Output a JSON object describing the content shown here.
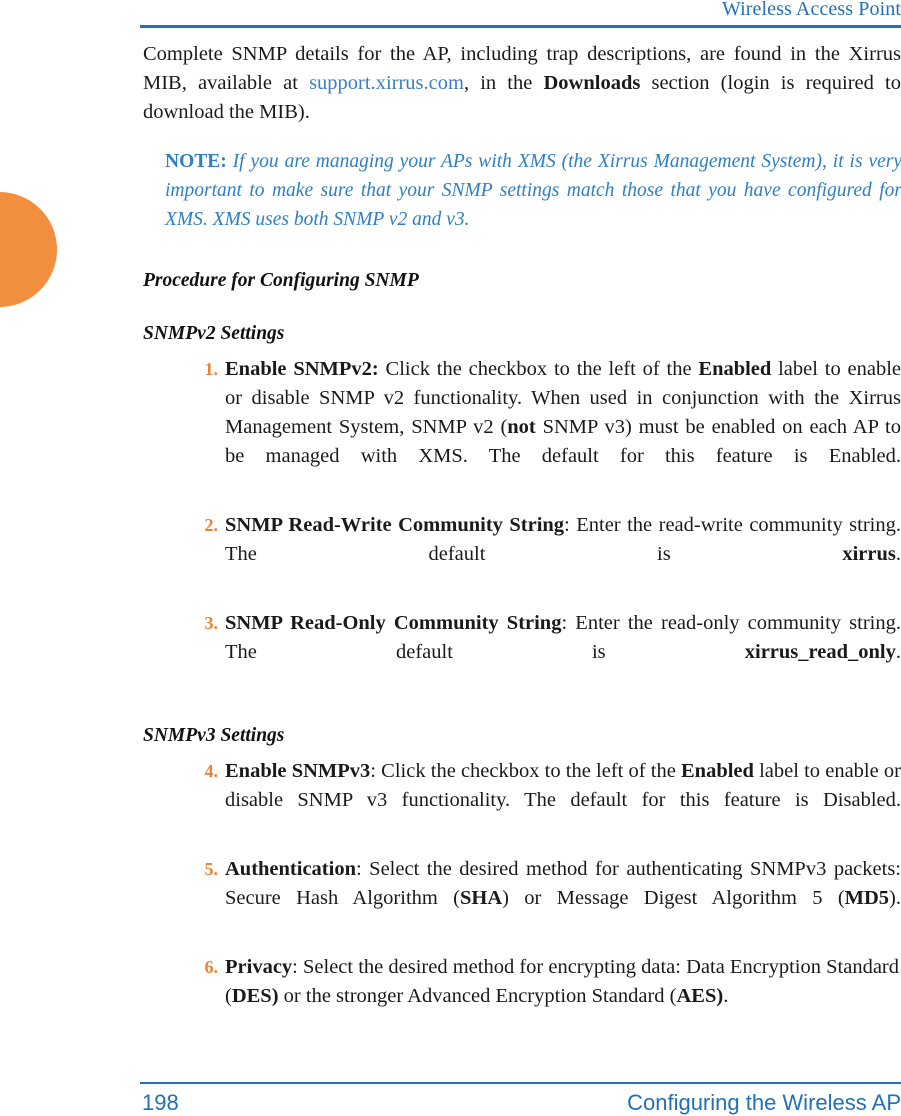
{
  "header": {
    "title": "Wireless Access Point"
  },
  "decor": {
    "thumb_tab_color": "#F28F3E",
    "rule_color": "#2170B8",
    "link_color": "#3D7EBE",
    "note_color": "#2E7FC4",
    "number_color": "#F08033"
  },
  "intro": {
    "segment_1": "Complete SNMP details for the AP, including trap descriptions, are found in the Xirrus MIB, available at ",
    "link_text": "support.xirrus.com",
    "segment_2": ", in the ",
    "bold_downloads": "Downloads",
    "segment_3": " section (login is required to download the MIB)."
  },
  "note": {
    "label": "NOTE:",
    "text": " If you are managing your APs with XMS (the Xirrus Management System), it is very important to make sure that your SNMP settings match those that you have configured for XMS. XMS uses both SNMP v2 and v3."
  },
  "procedure_heading": "Procedure for Configuring SNMP",
  "sections": [
    {
      "heading": "SNMPv2 Settings",
      "steps": [
        {
          "number": "1.",
          "bold_lead": "Enable SNMPv2:",
          "text_a": " Click the checkbox to the left of the ",
          "bold_mid": "Enabled",
          "text_b": " label to enable or disable SNMP v2 functionality. When used in conjunction with the Xirrus Management System, SNMP v2 (",
          "bold_mid_2": "not",
          "text_c": " SNMP v3) must be enabled on each AP to be managed with XMS. The default for this feature is Enabled."
        },
        {
          "number": "2.",
          "bold_lead": "SNMP Read-Write Community String",
          "text_a": ": Enter the read-write community string. The default is ",
          "bold_mid": "xirrus",
          "text_b": "."
        },
        {
          "number": "3.",
          "bold_lead": "SNMP Read-Only Community String",
          "text_a": ": Enter the read-only community string. The default is ",
          "bold_mid": "xirrus_read_only",
          "text_b": "."
        }
      ]
    },
    {
      "heading": "SNMPv3 Settings",
      "steps": [
        {
          "number": "4.",
          "bold_lead": "Enable SNMPv3",
          "text_a": ": Click the checkbox to the left of the ",
          "bold_mid": "Enabled",
          "text_b": " label to enable or disable SNMP v3 functionality. The default for this feature is Disabled."
        },
        {
          "number": "5.",
          "bold_lead": "Authentication",
          "text_a": ": Select the desired method for authenticating SNMPv3 packets: Secure Hash Algorithm (",
          "bold_mid": "SHA",
          "text_b": ") or Message Digest Algorithm 5 (",
          "bold_mid_2": "MD5",
          "text_c": ")."
        },
        {
          "number": "6.",
          "bold_lead": "Privacy",
          "text_a": ": Select the desired method for encrypting data: Data Encryption Standard (",
          "bold_mid": "DES)",
          "text_b": " or the stronger Advanced Encryption Standard (",
          "bold_mid_2": "AES)",
          "text_c": "."
        }
      ]
    }
  ],
  "footer": {
    "page_number": "198",
    "section_title": "Configuring the Wireless AP"
  }
}
